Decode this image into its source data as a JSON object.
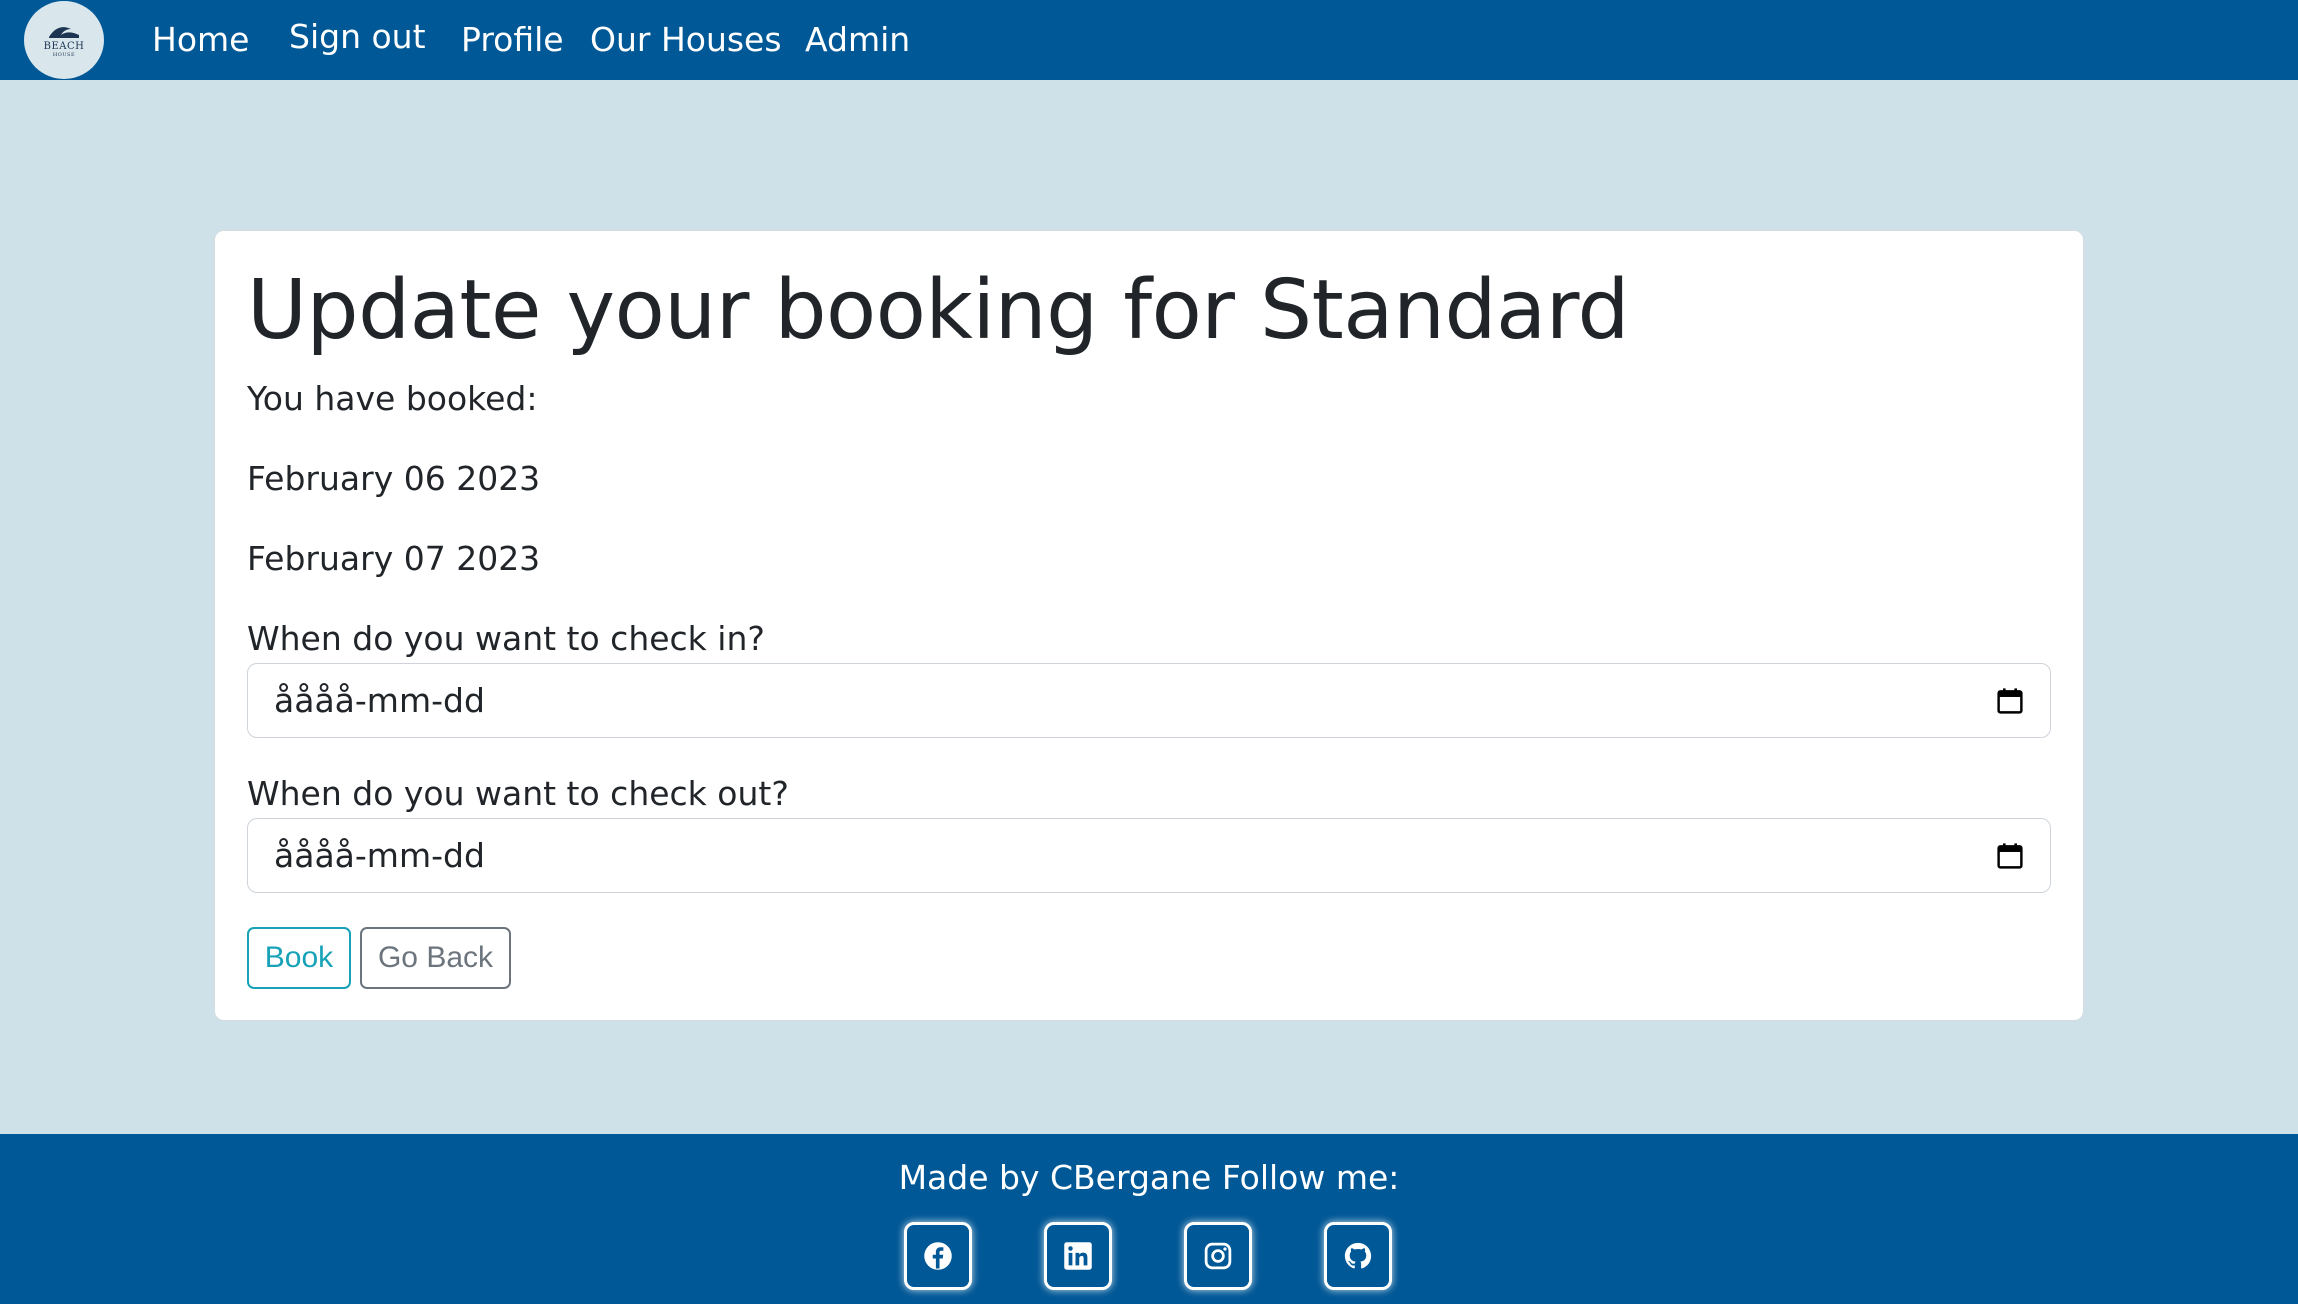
{
  "brand": {
    "logo_text": "BEACH",
    "logo_subtext": "HOUSE"
  },
  "nav": {
    "home": "Home",
    "sign_out": "Sign out",
    "profile": "Profile",
    "our_houses": "Our Houses",
    "admin": "Admin"
  },
  "booking": {
    "title": "Update your booking for Standard",
    "booked_label": "You have booked:",
    "booked_dates": [
      "February 06 2023",
      "February 07 2023"
    ],
    "check_in_label": "When do you want to check in?",
    "check_in_placeholder": "åååå-mm-dd",
    "check_out_label": "When do you want to check out?",
    "check_out_placeholder": "åååå-mm-dd",
    "book_button": "Book",
    "back_button": "Go Back"
  },
  "footer": {
    "text": "Made by CBergane Follow me:",
    "social_icons": [
      "facebook-icon",
      "linkedin-icon",
      "instagram-icon",
      "github-icon"
    ]
  },
  "colors": {
    "primary": "#005896",
    "background": "#cfe1e8",
    "book_button": "#17a2b8",
    "back_button": "#6c757d"
  }
}
